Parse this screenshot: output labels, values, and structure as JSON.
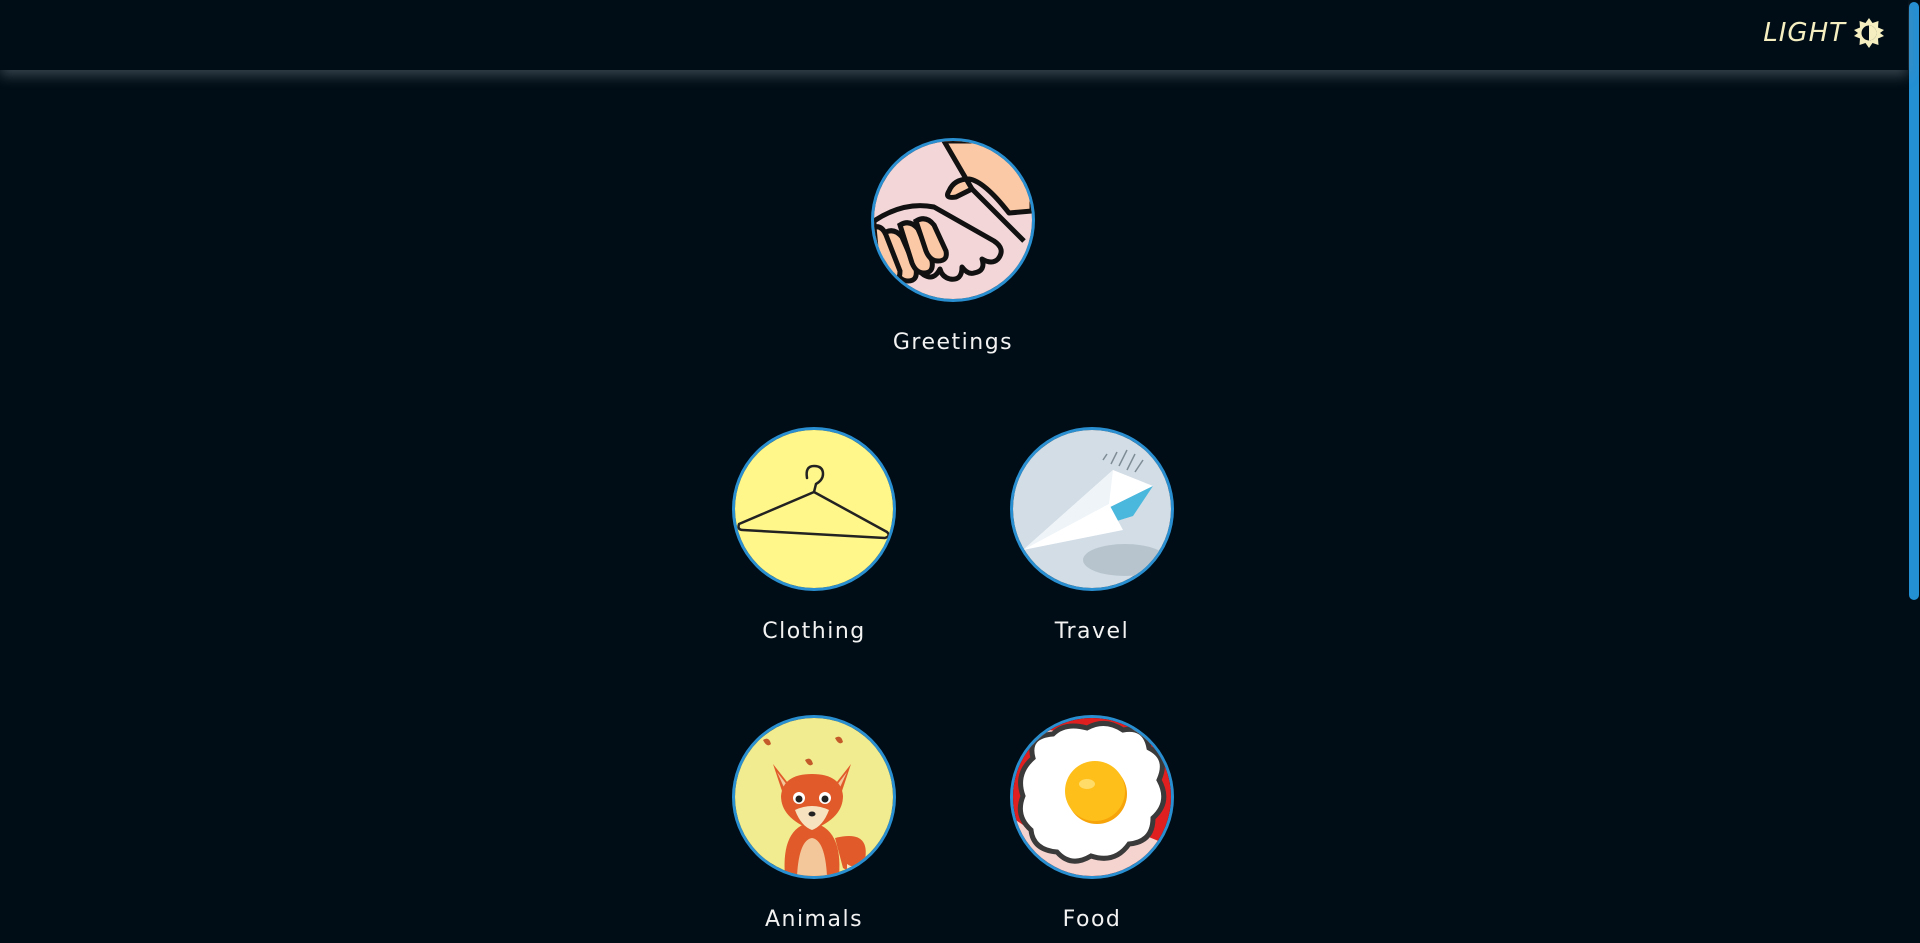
{
  "header": {
    "theme_toggle_label": "LIGHT",
    "theme_icon": "contrast-sun-icon",
    "label_color": "#f5eec0"
  },
  "categories": [
    {
      "label": "Greetings",
      "icon": "handshake-icon",
      "background": "#f3d6d8"
    },
    {
      "label": "Clothing",
      "icon": "hanger-icon",
      "background": "#fff78a"
    },
    {
      "label": "Travel",
      "icon": "paper-plane-icon",
      "background": "#d2dde6"
    },
    {
      "label": "Animals",
      "icon": "fox-icon",
      "background": "#f1ec8f"
    },
    {
      "label": "Food",
      "icon": "fried-egg-icon",
      "background": "#e02020"
    }
  ],
  "colors": {
    "background": "#000d16",
    "circle_border": "#2a8fd0",
    "scrollbar_thumb": "#2390d4",
    "label_text": "#f2f2f2"
  }
}
